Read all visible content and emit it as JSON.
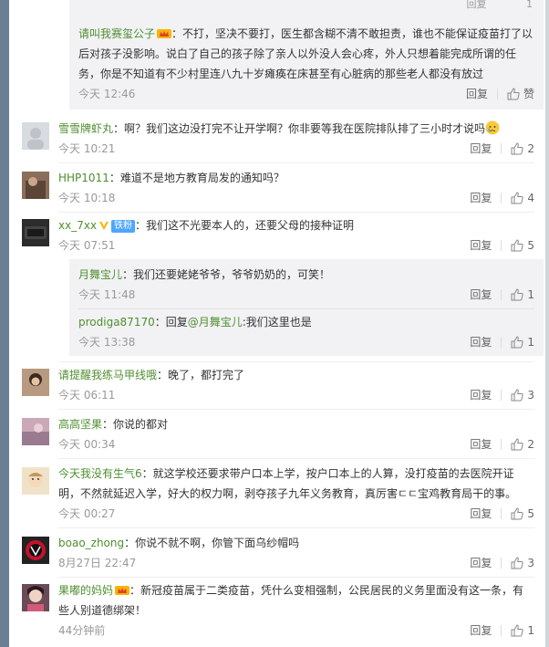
{
  "top_reply": {
    "ghost_reply": "回复",
    "ghost_like": "1",
    "user": "请叫我赛玺公子",
    "text": "：不打，坚决不要打，医生都含糊不清不敢担责，谁也不能保证疫苗打了以后对孩子没影响。说白了自己的孩子除了亲人以外没人会心疼，外人只想着能完成所谓的任务，你是不知道有不少村里连八九十岁瘫痪在床甚至有心脏病的那些老人都没有放过",
    "time": "今天 12:46",
    "reply": "回复",
    "like": "赞"
  },
  "comments": [
    {
      "user": "雪雪牌虾丸",
      "text": "：啊？我们这边没打完不让开学啊？你非要等我在医院排队排了三小时才说吗",
      "time": "今天 10:21",
      "reply": "回复",
      "likes": "2"
    },
    {
      "user": "HHP1011",
      "text": "：难道不是地方教育局发的通知吗？",
      "time": "今天 10:18",
      "reply": "回复",
      "likes": "4"
    },
    {
      "user": "xx_7xx",
      "fan_badge": "铁粉",
      "text": "：我们这不光要本人的，还要父母的接种证明",
      "time": "今天 07:51",
      "reply": "回复",
      "likes": "5"
    },
    {
      "user": "请提醒我练马甲线哦",
      "text": "：晚了，都打完了",
      "time": "今天 06:11",
      "reply": "回复",
      "likes": "3"
    },
    {
      "user": "高高坚果",
      "text": "：你说的都对",
      "time": "今天 00:34",
      "reply": "回复",
      "likes": "2"
    },
    {
      "user": "今天我没有生气6",
      "text": "：就这学校还要求带户口本上学，按户口本上的人算，没打疫苗的去医院开证明，不然就延迟入学，好大的权力啊，剥夺孩子九年义务教育，真厉害ㄷㄷ宝鸡教育局干的事。",
      "time": "今天 00:27",
      "reply": "回复",
      "likes": "5"
    },
    {
      "user": "boao_zhong",
      "text": "：你说不就不啊，你管下面乌纱帽吗",
      "time": "8月27日 22:47",
      "reply": "回复",
      "likes": "3"
    },
    {
      "user": "果嘟的妈妈",
      "text": "：新冠疫苗属于二类疫苗，凭什么变相强制，公民居民的义务里面没有这一条，有些人别道德绑架！",
      "time": "44分钟前",
      "reply": "回复",
      "likes": "1"
    }
  ],
  "sub_replies": [
    {
      "user": "月舞宝儿",
      "text": "：我们还要姥姥爷爷，爷爷奶奶的，可笑！",
      "time": "今天 11:48",
      "reply": "回复",
      "likes": "1"
    },
    {
      "user": "prodiga87170",
      "text_prefix": "：回复",
      "mention": "@月舞宝儿",
      "text": ":我们这里也是",
      "time": "今天 13:38",
      "reply": "回复",
      "likes": "1"
    }
  ],
  "colors": {
    "username": "#4f8f2f",
    "mention": "#eb7350",
    "meta": "#999999",
    "reply_box": "#f2f2f5"
  }
}
